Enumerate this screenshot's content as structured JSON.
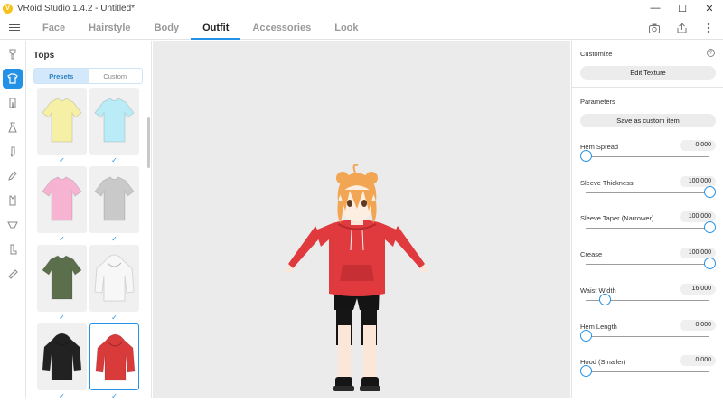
{
  "window": {
    "title": "VRoid Studio 1.4.2 - Untitled*",
    "controls": [
      "—",
      "☐",
      "✕"
    ]
  },
  "nav": {
    "tabs": [
      "Face",
      "Hairstyle",
      "Body",
      "Outfit",
      "Accessories",
      "Look"
    ],
    "active_tab": "Outfit",
    "icons": [
      "camera-icon",
      "share-icon",
      "more-icon"
    ]
  },
  "left_rail": {
    "items": [
      "hair-icon",
      "tops-icon",
      "bottoms-icon",
      "onepiece-icon",
      "socks-icon",
      "shoes-icon",
      "undershirt-icon",
      "underwear-icon",
      "boots-icon",
      "accessory-icon"
    ],
    "active_index": 1
  },
  "tops_panel": {
    "title": "Tops",
    "segments": [
      "Presets",
      "Custom"
    ],
    "active_segment": "Presets",
    "items": [
      {
        "name": "yellow-tshirt",
        "color": "#f6f0a6",
        "style": "tee",
        "checked": true
      },
      {
        "name": "cyan-tshirt",
        "color": "#b9ecf6",
        "style": "tee",
        "checked": true
      },
      {
        "name": "pink-tshirt",
        "color": "#f6b3d2",
        "style": "tee",
        "checked": true
      },
      {
        "name": "gray-tshirt",
        "color": "#c9c9c9",
        "style": "tee",
        "checked": true
      },
      {
        "name": "green-tshirt",
        "color": "#5b6f4c",
        "style": "tee",
        "checked": true
      },
      {
        "name": "white-hoodie",
        "color": "#f7f7f7",
        "style": "hoodie",
        "checked": true
      },
      {
        "name": "black-hoodie",
        "color": "#222222",
        "style": "hoodie",
        "checked": true
      },
      {
        "name": "red-hoodie",
        "color": "#d93a3a",
        "style": "hoodie",
        "checked": true,
        "selected": true
      }
    ]
  },
  "right_panel": {
    "customize_label": "Customize",
    "edit_texture_button": "Edit Texture",
    "parameters_label": "Parameters",
    "save_custom_button": "Save as custom item",
    "parameters": [
      {
        "name": "Hem Spread",
        "value": "0.000",
        "fraction": 0.0
      },
      {
        "name": "Sleeve Thickness",
        "value": "100.000",
        "fraction": 1.0
      },
      {
        "name": "Sleeve Taper (Narrower)",
        "value": "100.000",
        "fraction": 1.0
      },
      {
        "name": "Crease",
        "value": "100.000",
        "fraction": 1.0
      },
      {
        "name": "Waist Width",
        "value": "16.000",
        "fraction": 0.16
      },
      {
        "name": "Hem Length",
        "value": "0.000",
        "fraction": 0.0
      },
      {
        "name": "Hood (Smaller)",
        "value": "0.000",
        "fraction": 0.0
      }
    ]
  },
  "colors": {
    "accent": "#2391e6",
    "viewport_bg": "#ebebeb",
    "hoodie": "#e03a3e",
    "hair": "#f2a552"
  }
}
